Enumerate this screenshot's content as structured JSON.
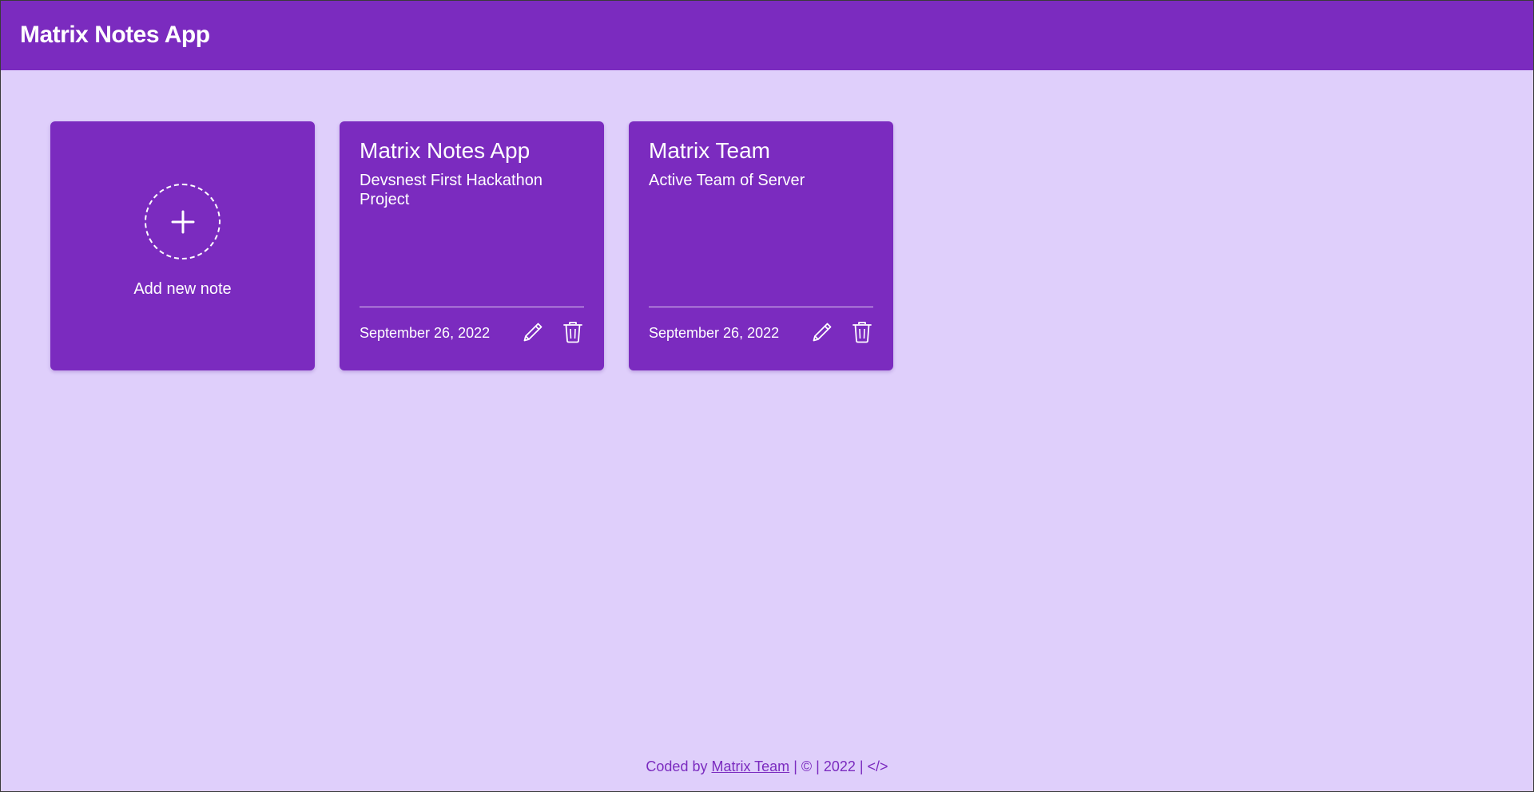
{
  "header": {
    "title": "Matrix Notes App"
  },
  "add_card": {
    "label": "Add new note",
    "icon": "plus-icon"
  },
  "notes": [
    {
      "title": "Matrix Notes App",
      "body": "Devsnest First Hackathon Project",
      "date": "September 26, 2022"
    },
    {
      "title": "Matrix Team",
      "body": "Active Team of Server",
      "date": "September 26, 2022"
    }
  ],
  "note_actions": {
    "edit_icon": "pencil-icon",
    "delete_icon": "trash-icon"
  },
  "footer": {
    "prefix": "Coded by",
    "link_text": "Matrix Team",
    "suffix": "| © | 2022 | </>"
  },
  "colors": {
    "header_bg": "#7b2bbf",
    "page_bg": "#dfcffb",
    "card_bg": "#7b2bbf",
    "text_on_card": "#ffffff",
    "footer_text": "#7b2bbf"
  }
}
